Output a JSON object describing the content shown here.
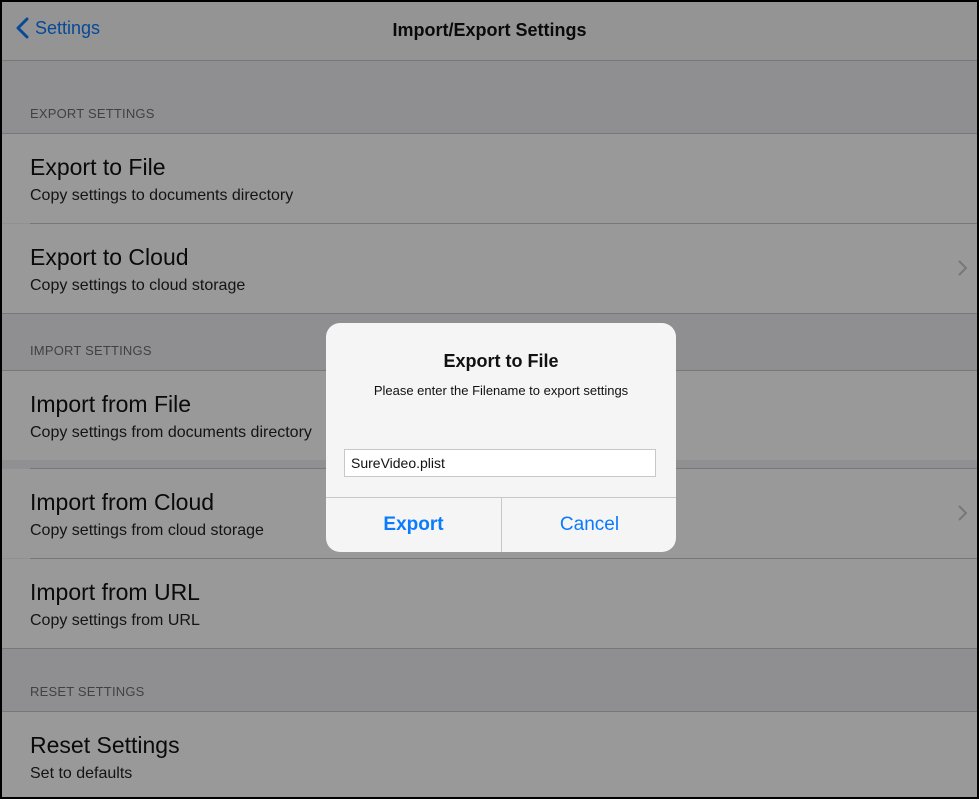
{
  "colors": {
    "accent": "#0a7aff",
    "background": "#efeff4",
    "dim_overlay": "rgba(0,0,0,0.40)"
  },
  "navbar": {
    "back_label": "Settings",
    "back_icon": "chevron-left-icon",
    "title": "Import/Export Settings"
  },
  "sections": [
    {
      "header": "EXPORT SETTINGS",
      "items": [
        {
          "title": "Export to File",
          "subtitle": "Copy settings to documents directory",
          "has_chevron": false
        },
        {
          "title": "Export to Cloud",
          "subtitle": "Copy settings to cloud storage",
          "has_chevron": true
        }
      ]
    },
    {
      "header": "IMPORT SETTINGS",
      "items": [
        {
          "title": "Import from File",
          "subtitle": "Copy settings from documents directory",
          "has_chevron": false
        },
        {
          "title": "Import from Cloud",
          "subtitle": "Copy settings from cloud storage",
          "has_chevron": true
        },
        {
          "title": "Import from URL",
          "subtitle": "Copy settings from URL",
          "has_chevron": false
        }
      ]
    },
    {
      "header": "RESET SETTINGS",
      "items": [
        {
          "title": "Reset Settings",
          "subtitle": "Set to defaults",
          "has_chevron": false
        }
      ]
    }
  ],
  "alert": {
    "title": "Export to File",
    "message": "Please enter the Filename to export settings",
    "input_value": "SureVideo.plist",
    "buttons": {
      "export": "Export",
      "cancel": "Cancel"
    }
  }
}
